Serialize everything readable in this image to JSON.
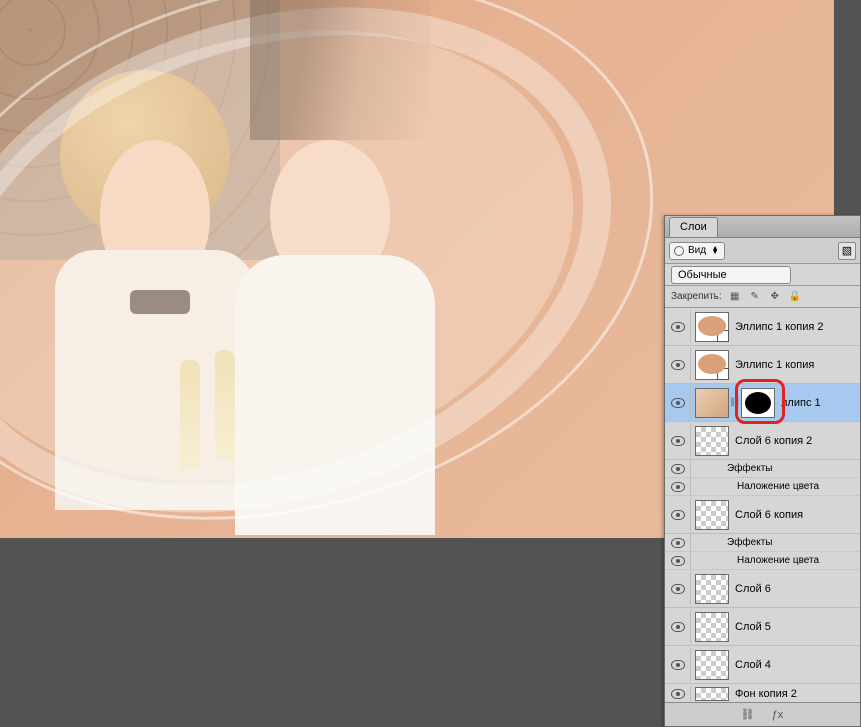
{
  "panel": {
    "tab": "Слои",
    "kind_label": "Вид",
    "mode": "Обычные",
    "lock_label": "Закрепить:"
  },
  "layers": [
    {
      "name": "Эллипс 1 копия 2",
      "type": "smart-ellipse"
    },
    {
      "name": "Эллипс 1 копия",
      "type": "smart-ellipse"
    },
    {
      "name": "ллипс 1",
      "type": "masked-selected"
    },
    {
      "name": "Слой 6 копия 2",
      "type": "raster-transp",
      "fx": {
        "label": "Эффекты",
        "items": [
          "Наложение цвета"
        ]
      }
    },
    {
      "name": "Слой 6 копия",
      "type": "raster-transp",
      "fx": {
        "label": "Эффекты",
        "items": [
          "Наложение цвета"
        ]
      }
    },
    {
      "name": "Слой 6",
      "type": "raster-transp"
    },
    {
      "name": "Слой 5",
      "type": "raster-transp"
    },
    {
      "name": "Слой 4",
      "type": "raster-transp"
    },
    {
      "name": "Фон копия 2",
      "type": "raster-transp"
    }
  ]
}
